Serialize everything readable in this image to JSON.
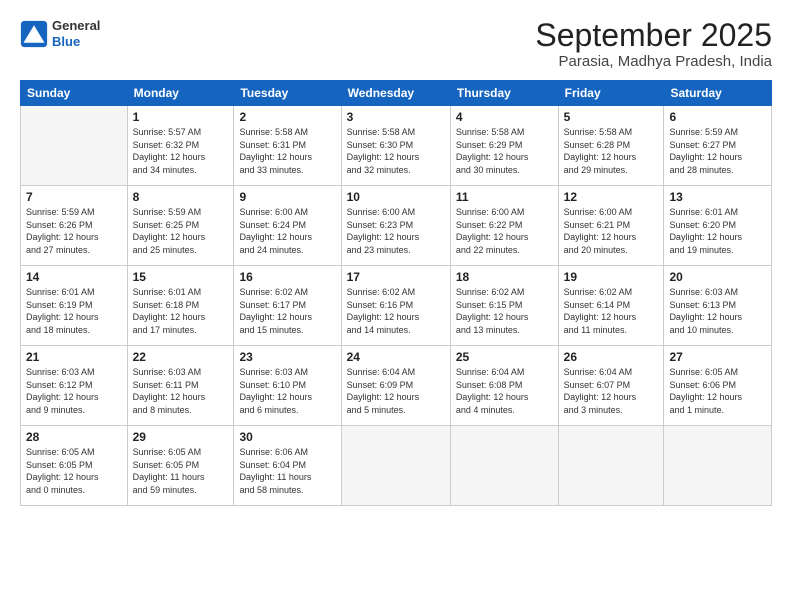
{
  "header": {
    "logo_general": "General",
    "logo_blue": "Blue",
    "month_title": "September 2025",
    "subtitle": "Parasia, Madhya Pradesh, India"
  },
  "weekdays": [
    "Sunday",
    "Monday",
    "Tuesday",
    "Wednesday",
    "Thursday",
    "Friday",
    "Saturday"
  ],
  "weeks": [
    [
      {
        "day": "",
        "info": ""
      },
      {
        "day": "1",
        "info": "Sunrise: 5:57 AM\nSunset: 6:32 PM\nDaylight: 12 hours\nand 34 minutes."
      },
      {
        "day": "2",
        "info": "Sunrise: 5:58 AM\nSunset: 6:31 PM\nDaylight: 12 hours\nand 33 minutes."
      },
      {
        "day": "3",
        "info": "Sunrise: 5:58 AM\nSunset: 6:30 PM\nDaylight: 12 hours\nand 32 minutes."
      },
      {
        "day": "4",
        "info": "Sunrise: 5:58 AM\nSunset: 6:29 PM\nDaylight: 12 hours\nand 30 minutes."
      },
      {
        "day": "5",
        "info": "Sunrise: 5:58 AM\nSunset: 6:28 PM\nDaylight: 12 hours\nand 29 minutes."
      },
      {
        "day": "6",
        "info": "Sunrise: 5:59 AM\nSunset: 6:27 PM\nDaylight: 12 hours\nand 28 minutes."
      }
    ],
    [
      {
        "day": "7",
        "info": "Sunrise: 5:59 AM\nSunset: 6:26 PM\nDaylight: 12 hours\nand 27 minutes."
      },
      {
        "day": "8",
        "info": "Sunrise: 5:59 AM\nSunset: 6:25 PM\nDaylight: 12 hours\nand 25 minutes."
      },
      {
        "day": "9",
        "info": "Sunrise: 6:00 AM\nSunset: 6:24 PM\nDaylight: 12 hours\nand 24 minutes."
      },
      {
        "day": "10",
        "info": "Sunrise: 6:00 AM\nSunset: 6:23 PM\nDaylight: 12 hours\nand 23 minutes."
      },
      {
        "day": "11",
        "info": "Sunrise: 6:00 AM\nSunset: 6:22 PM\nDaylight: 12 hours\nand 22 minutes."
      },
      {
        "day": "12",
        "info": "Sunrise: 6:00 AM\nSunset: 6:21 PM\nDaylight: 12 hours\nand 20 minutes."
      },
      {
        "day": "13",
        "info": "Sunrise: 6:01 AM\nSunset: 6:20 PM\nDaylight: 12 hours\nand 19 minutes."
      }
    ],
    [
      {
        "day": "14",
        "info": "Sunrise: 6:01 AM\nSunset: 6:19 PM\nDaylight: 12 hours\nand 18 minutes."
      },
      {
        "day": "15",
        "info": "Sunrise: 6:01 AM\nSunset: 6:18 PM\nDaylight: 12 hours\nand 17 minutes."
      },
      {
        "day": "16",
        "info": "Sunrise: 6:02 AM\nSunset: 6:17 PM\nDaylight: 12 hours\nand 15 minutes."
      },
      {
        "day": "17",
        "info": "Sunrise: 6:02 AM\nSunset: 6:16 PM\nDaylight: 12 hours\nand 14 minutes."
      },
      {
        "day": "18",
        "info": "Sunrise: 6:02 AM\nSunset: 6:15 PM\nDaylight: 12 hours\nand 13 minutes."
      },
      {
        "day": "19",
        "info": "Sunrise: 6:02 AM\nSunset: 6:14 PM\nDaylight: 12 hours\nand 11 minutes."
      },
      {
        "day": "20",
        "info": "Sunrise: 6:03 AM\nSunset: 6:13 PM\nDaylight: 12 hours\nand 10 minutes."
      }
    ],
    [
      {
        "day": "21",
        "info": "Sunrise: 6:03 AM\nSunset: 6:12 PM\nDaylight: 12 hours\nand 9 minutes."
      },
      {
        "day": "22",
        "info": "Sunrise: 6:03 AM\nSunset: 6:11 PM\nDaylight: 12 hours\nand 8 minutes."
      },
      {
        "day": "23",
        "info": "Sunrise: 6:03 AM\nSunset: 6:10 PM\nDaylight: 12 hours\nand 6 minutes."
      },
      {
        "day": "24",
        "info": "Sunrise: 6:04 AM\nSunset: 6:09 PM\nDaylight: 12 hours\nand 5 minutes."
      },
      {
        "day": "25",
        "info": "Sunrise: 6:04 AM\nSunset: 6:08 PM\nDaylight: 12 hours\nand 4 minutes."
      },
      {
        "day": "26",
        "info": "Sunrise: 6:04 AM\nSunset: 6:07 PM\nDaylight: 12 hours\nand 3 minutes."
      },
      {
        "day": "27",
        "info": "Sunrise: 6:05 AM\nSunset: 6:06 PM\nDaylight: 12 hours\nand 1 minute."
      }
    ],
    [
      {
        "day": "28",
        "info": "Sunrise: 6:05 AM\nSunset: 6:05 PM\nDaylight: 12 hours\nand 0 minutes."
      },
      {
        "day": "29",
        "info": "Sunrise: 6:05 AM\nSunset: 6:05 PM\nDaylight: 11 hours\nand 59 minutes."
      },
      {
        "day": "30",
        "info": "Sunrise: 6:06 AM\nSunset: 6:04 PM\nDaylight: 11 hours\nand 58 minutes."
      },
      {
        "day": "",
        "info": ""
      },
      {
        "day": "",
        "info": ""
      },
      {
        "day": "",
        "info": ""
      },
      {
        "day": "",
        "info": ""
      }
    ]
  ]
}
